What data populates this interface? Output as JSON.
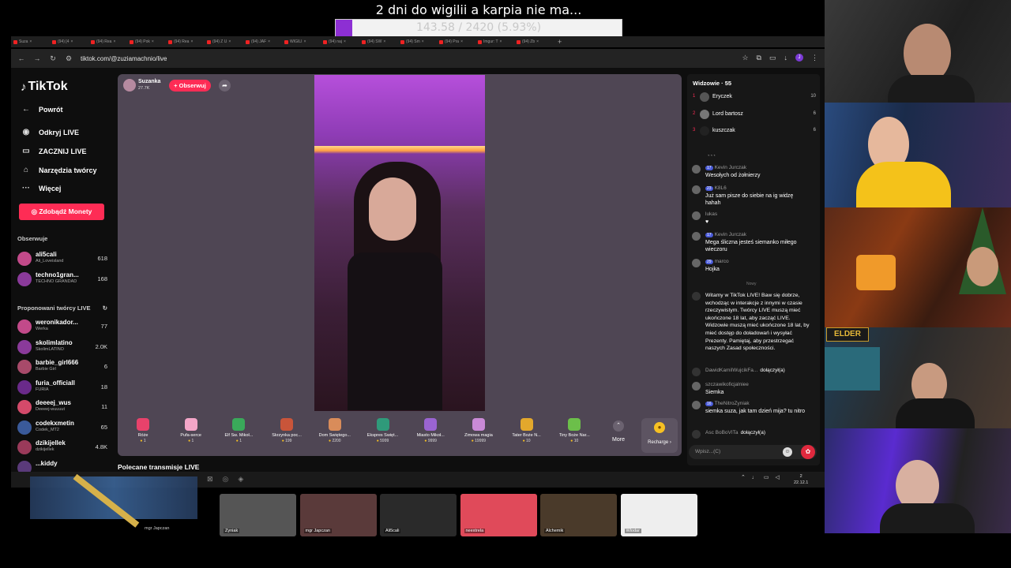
{
  "overlay": {
    "goal_title": "2 dni do wigilii a karpia nie ma...",
    "goal_text": "143.58 / 2420 (5.93%)",
    "goal_progress": 0.0593,
    "goal_color": "#8d2fd3"
  },
  "browser": {
    "tabs": [
      "Suza",
      "(94) [4",
      "(94) Rea",
      "(94) Pok",
      "(94) Rea",
      "(94) Z U",
      "(94) JAF",
      "WIGILI",
      "(94) naj",
      "(94) SW",
      "(94) Sm",
      "(94) Pra",
      "Imgur: T",
      "(94) Zb"
    ],
    "new_tab": "+",
    "url": "tiktok.com/@zuziamachnio/live"
  },
  "tiktok": {
    "logo": "TikTok",
    "nav": {
      "back": "Powrót",
      "discover": "Odkryj LIVE",
      "start": "ZACZNIJ LIVE",
      "tools": "Narzędzia twórcy",
      "more": "Więcej"
    },
    "coins_button": "Zdobądź Monety",
    "following_header": "Obserwuje",
    "following": [
      {
        "name": "ali5cali",
        "sub": "Ali_Loveisland",
        "count": "618"
      },
      {
        "name": "techno1gran...",
        "sub": "TECHNO GRANDAD",
        "count": "168"
      }
    ],
    "suggested_header": "Proponowani twórcy LIVE",
    "suggested": [
      {
        "name": "weronikador...",
        "sub": "Werka",
        "count": "77"
      },
      {
        "name": "skolimlatino",
        "sub": "SkolimLATINO",
        "count": "2.0K"
      },
      {
        "name": "barbie_girl666",
        "sub": "Barbie Girl",
        "count": "6"
      },
      {
        "name": "furia_officiall",
        "sub": "FURIA",
        "count": "18"
      },
      {
        "name": "deeeej_wus",
        "sub": "Deeeej-wuuuut",
        "count": "11"
      },
      {
        "name": "codekxmetin",
        "sub": "Codek_MT2",
        "count": "65"
      },
      {
        "name": "dzikijellek",
        "sub": "dzikijellek",
        "count": "4.8K"
      },
      {
        "name": "...kiddy",
        "sub": "",
        "count": ""
      }
    ],
    "host": {
      "name": "Suzanka",
      "likes": "27.7K",
      "follow": "+ Obserwuj"
    },
    "gifts": [
      {
        "name": "Róże",
        "price": "1",
        "color": "#e8426b"
      },
      {
        "name": "Pufa-serce",
        "price": "1",
        "color": "#f4a6c8"
      },
      {
        "name": "Elf Św. Mikoł...",
        "price": "1",
        "color": "#3aa95a"
      },
      {
        "name": "Skrzynka poc...",
        "price": "199",
        "color": "#c9553a"
      },
      {
        "name": "Dom Świętego...",
        "price": "2200",
        "color": "#d98c5a"
      },
      {
        "name": "Ekspres Święt...",
        "price": "5999",
        "color": "#2f9a7a"
      },
      {
        "name": "Miasto Mikoł...",
        "price": "9999",
        "color": "#9a64d1"
      },
      {
        "name": "Zimowa magia",
        "price": "19999",
        "color": "#c98ad6"
      },
      {
        "name": "Tater Boże N...",
        "price": "10",
        "color": "#e3a82c"
      },
      {
        "name": "Tiny Boże Nar...",
        "price": "10",
        "color": "#6cbf4a"
      }
    ],
    "more_label": "More",
    "recharge_label": "Recharge",
    "viewers_header": "Widzowie · 55",
    "viewers": [
      {
        "rank": "1",
        "name": "Eryczek",
        "score": "10"
      },
      {
        "rank": "2",
        "name": "Lord bartosz",
        "score": "6"
      },
      {
        "rank": "3",
        "name": "kuszczak",
        "score": "6"
      }
    ],
    "messages": [
      {
        "badge": "17",
        "user": "Kevin Jurczak",
        "text": "Wesołych od żołnierzy"
      },
      {
        "badge": "23",
        "user": "K8L6",
        "text": "Już sam pisze do siebie na ig widzę hahah"
      },
      {
        "badge": "",
        "user": "lukas",
        "text": "♥"
      },
      {
        "badge": "17",
        "user": "Kevin Jurczak",
        "text": "Mega śliczna jesteś siemanko miłego wieczoru"
      },
      {
        "badge": "29",
        "user": "marco",
        "text": "Hojka"
      }
    ],
    "new_label": "Nowy",
    "system_message": "Witamy w TikTok LIVE! Baw się dobrze, wchodząc w interakcje z innymi w czasie rzeczywistym. Twórcy LIVE muszą mieć ukończone 18 lat, aby zacząć LIVE. Widzowie muszą mieć ukończone 18 lat, by mieć dostęp do doładowań i wysyłać Prezenty. Pamiętaj, aby przestrzegać naszych Zasad społeczności.",
    "joins": [
      {
        "user": "DawidKamilWujcikFa...",
        "action": "dołączył(a)"
      }
    ],
    "later_messages": [
      {
        "badge": "",
        "user": "szczawikoficjalniee",
        "text": "Siemka"
      },
      {
        "badge": "16",
        "user": "TheNitroZyniak",
        "text": "siemka suza, jak tam dzień mija? tu nitro"
      }
    ],
    "join2": {
      "user": "Asc BoBoVITa",
      "action": "dołączył(a)"
    },
    "chat_placeholder": "Wpisz...(C)",
    "recommended": "Polecane transmisje LIVE"
  },
  "taskbar": {
    "clock_time": "2",
    "clock_date": "22.12.1"
  },
  "webcam_label": "ELDER",
  "thumbs": [
    {
      "label": "Zyniak"
    },
    {
      "label": "mgr Japczan"
    },
    {
      "label": "Ali5cali"
    },
    {
      "label": "neextrela"
    },
    {
      "label": "Alchemik"
    },
    {
      "label": "Wlodar"
    }
  ],
  "user_chip": "mgr Japczan"
}
